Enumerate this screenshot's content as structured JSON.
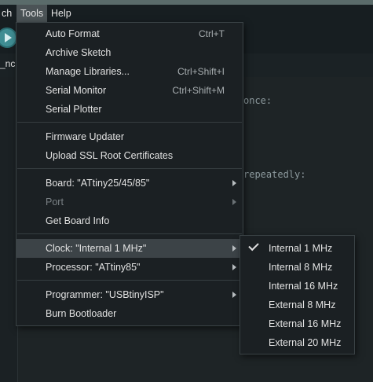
{
  "menubar": {
    "items": [
      {
        "label": "ch"
      },
      {
        "label": "Tools"
      },
      {
        "label": "Help"
      }
    ]
  },
  "tab": {
    "label": "_nc"
  },
  "editor": {
    "lines": [
      " once:",
      "repeatedly:"
    ]
  },
  "tools_menu": {
    "items": [
      {
        "label": "Auto Format",
        "shortcut": "Ctrl+T"
      },
      {
        "label": "Archive Sketch"
      },
      {
        "label": "Manage Libraries...",
        "shortcut": "Ctrl+Shift+I"
      },
      {
        "label": "Serial Monitor",
        "shortcut": "Ctrl+Shift+M"
      },
      {
        "label": "Serial Plotter"
      },
      {
        "label": "Firmware Updater"
      },
      {
        "label": "Upload SSL Root Certificates"
      },
      {
        "label": "Board: \"ATtiny25/45/85\"",
        "submenu": true
      },
      {
        "label": "Port",
        "submenu": true,
        "disabled": true
      },
      {
        "label": "Get Board Info"
      },
      {
        "label": "Clock: \"Internal 1 MHz\"",
        "submenu": true,
        "highlighted": true
      },
      {
        "label": "Processor: \"ATtiny85\"",
        "submenu": true
      },
      {
        "label": "Programmer: \"USBtinyISP\"",
        "submenu": true
      },
      {
        "label": "Burn Bootloader"
      }
    ]
  },
  "clock_submenu": {
    "selected": "Internal 1 MHz",
    "items": [
      {
        "label": "Internal 1 MHz",
        "checked": true
      },
      {
        "label": "Internal 8 MHz"
      },
      {
        "label": "Internal 16 MHz"
      },
      {
        "label": "External 8 MHz"
      },
      {
        "label": "External 16 MHz"
      },
      {
        "label": "External 20 MHz"
      }
    ]
  },
  "colors": {
    "menu_bg": "#1b2023",
    "highlight": "#3c4347",
    "editor_bg": "#1e2426",
    "accent": "#3f8d93"
  },
  "icons": [
    "check-icon",
    "submenu-arrow-icon",
    "arduino-verify-icon"
  ]
}
